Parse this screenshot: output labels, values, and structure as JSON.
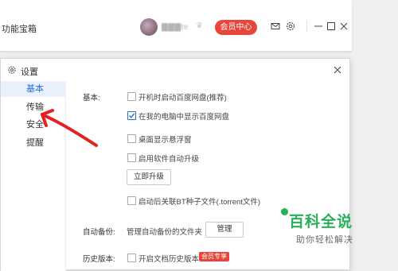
{
  "back_window": {
    "title": "功能宝箱",
    "username": "▇▇▇te",
    "vip_button": "会员中心"
  },
  "dialog": {
    "title": "设置",
    "nav": [
      {
        "label": "基本",
        "active": true
      },
      {
        "label": "传输",
        "active": false
      },
      {
        "label": "安全",
        "active": false
      },
      {
        "label": "提醒",
        "active": false
      }
    ],
    "basic": {
      "section_label": "基本:",
      "options": [
        {
          "label": "开机时启动百度网盘(推荐)",
          "checked": false
        },
        {
          "label": "在我的电脑中显示百度网盘",
          "checked": true
        },
        {
          "label": "桌面显示悬浮窗",
          "checked": false
        },
        {
          "label": "启用软件自动升级",
          "checked": false
        }
      ],
      "upgrade_button": "立即升级",
      "bt_option": {
        "label": "启动后关联BT种子文件(.torrent文件)",
        "checked": false
      }
    },
    "auto_backup": {
      "section_label": "自动备份:",
      "description": "管理自动备份的文件夹",
      "manage_button": "管理"
    },
    "history": {
      "section_label": "历史版本:",
      "option": {
        "label": "开启文档历史版本",
        "checked": false
      },
      "badge": "会员专享"
    }
  },
  "watermark": {
    "title": "百科全说",
    "subtitle": "助你轻松解决"
  },
  "colors": {
    "accent": "#2a6fd8",
    "vip_red": "#e8453c",
    "annotation_red": "#e32222",
    "watermark_green": "#26b05a"
  }
}
